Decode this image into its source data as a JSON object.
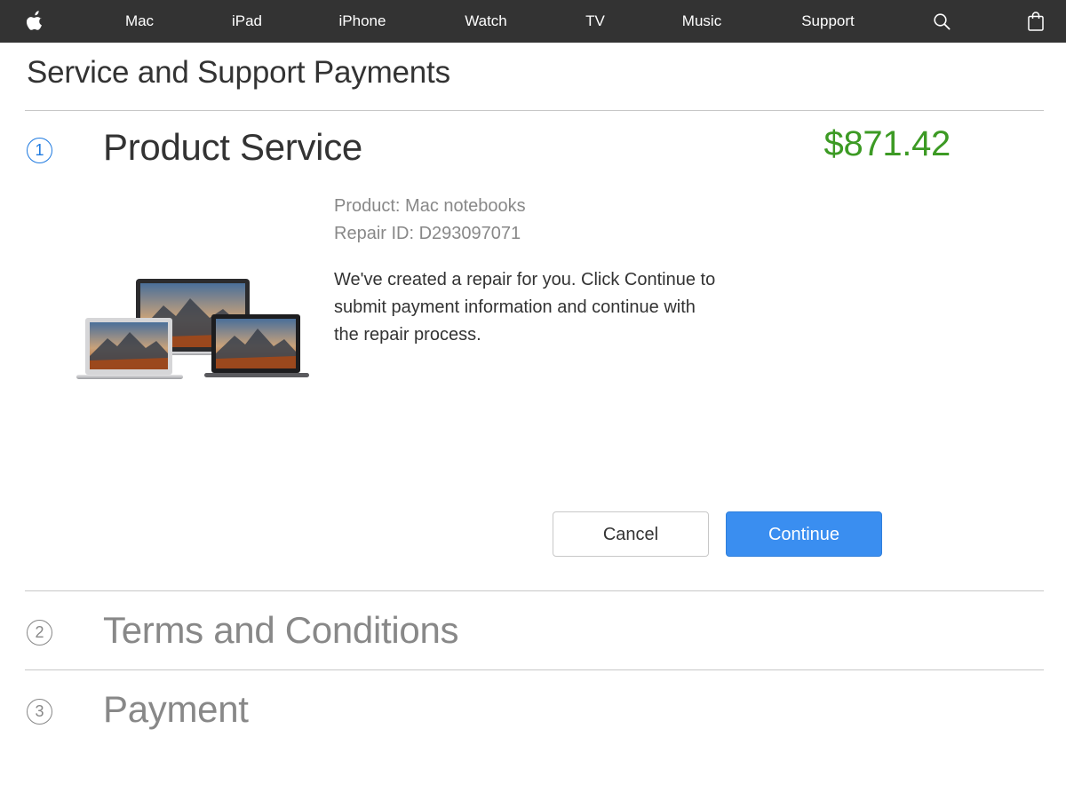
{
  "nav": {
    "logo_icon": "apple-logo-icon",
    "items": [
      "Mac",
      "iPad",
      "iPhone",
      "Watch",
      "TV",
      "Music",
      "Support"
    ],
    "search_icon": "search-icon",
    "bag_icon": "shopping-bag-icon"
  },
  "page": {
    "title": "Service and Support Payments"
  },
  "steps": [
    {
      "number": "1",
      "title": "Product Service",
      "active": true,
      "price": "$871.42",
      "product_line": "Product: Mac notebooks",
      "repair_line": "Repair ID: D293097071",
      "description": "We've created a repair for you. Click Continue to submit payment information and continue with the repair process.",
      "cancel_label": "Cancel",
      "continue_label": "Continue"
    },
    {
      "number": "2",
      "title": "Terms and Conditions",
      "active": false
    },
    {
      "number": "3",
      "title": "Payment",
      "active": false
    }
  ],
  "colors": {
    "nav_background": "#333333",
    "accent_blue": "#3a8ef0",
    "price_green": "#3c9a24",
    "muted_gray": "#888888"
  }
}
